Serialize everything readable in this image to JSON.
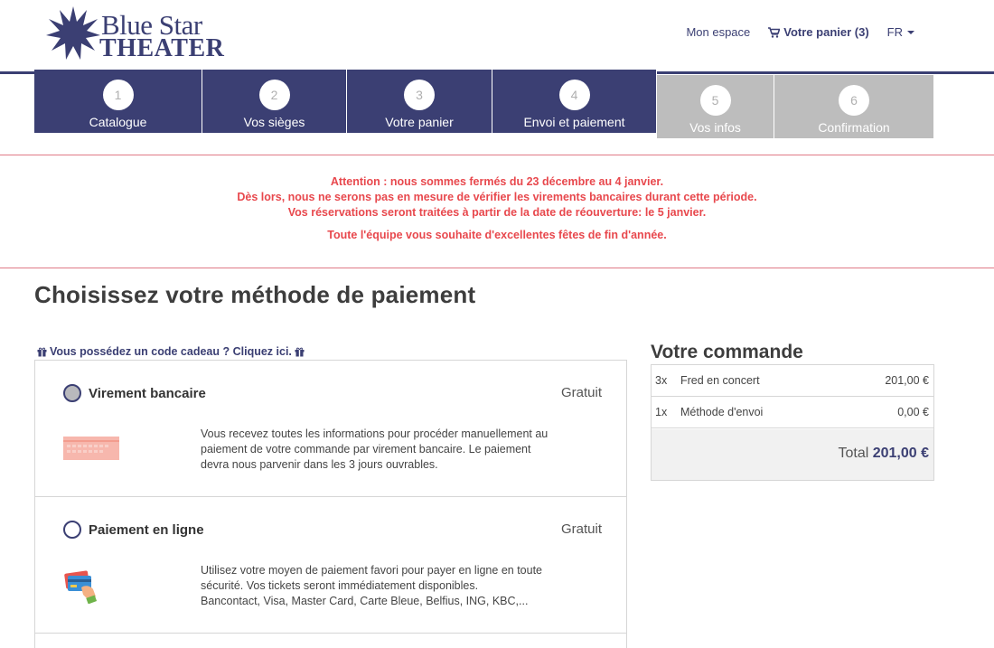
{
  "brand": {
    "line1": "Blue Star",
    "line2": "THEATER",
    "color": "#3b3f73"
  },
  "topnav": {
    "account": "Mon espace",
    "cart": "Votre panier (3)",
    "lang": "FR"
  },
  "steps": [
    {
      "num": "1",
      "label": "Catalogue",
      "active": true
    },
    {
      "num": "2",
      "label": "Vos sièges",
      "active": true
    },
    {
      "num": "3",
      "label": "Votre panier",
      "active": true
    },
    {
      "num": "4",
      "label": "Envoi et paiement",
      "active": true
    },
    {
      "num": "5",
      "label": "Vos infos",
      "active": false
    },
    {
      "num": "6",
      "label": "Confirmation",
      "active": false
    }
  ],
  "notice": {
    "line1": "Attention : nous sommes fermés du 23 décembre au 4 janvier.",
    "line2": "Dès lors, nous ne serons pas en mesure de vérifier les virements bancaires durant cette période.",
    "line3": "Vos réservations seront traitées à partir de la date de réouverture: le 5 janvier.",
    "line4": "Toute l'équipe vous souhaite d'excellentes fêtes de fin d'année.",
    "color": "#e8484d"
  },
  "page_title": "Choisissez votre méthode de paiement",
  "gift_link": "Vous possédez un code cadeau ? Cliquez ici.",
  "methods": [
    {
      "name": "Virement bancaire",
      "price": "Gratuit",
      "selected": true,
      "desc": [
        "Vous recevez toutes les informations pour procéder manuellement au",
        "paiement de votre commande par virement bancaire. Le paiement",
        "devra nous parvenir dans les 3 jours ouvrables."
      ]
    },
    {
      "name": "Paiement en ligne",
      "price": "Gratuit",
      "selected": false,
      "desc": [
        "Utilisez votre moyen de paiement favori pour payer en ligne en toute",
        "sécurité. Vos tickets seront immédiatement disponibles.",
        "Bancontact, Visa, Master Card, Carte Bleue, Belfius, ING, KBC,..."
      ]
    }
  ],
  "order": {
    "title": "Votre commande",
    "items": [
      {
        "qty": "3x",
        "name": "Fred en concert",
        "price": "201,00 €"
      },
      {
        "qty": "1x",
        "name": "Méthode d'envoi",
        "price": "0,00 €"
      }
    ],
    "total_label": "Total",
    "total_value": "201,00 €"
  }
}
